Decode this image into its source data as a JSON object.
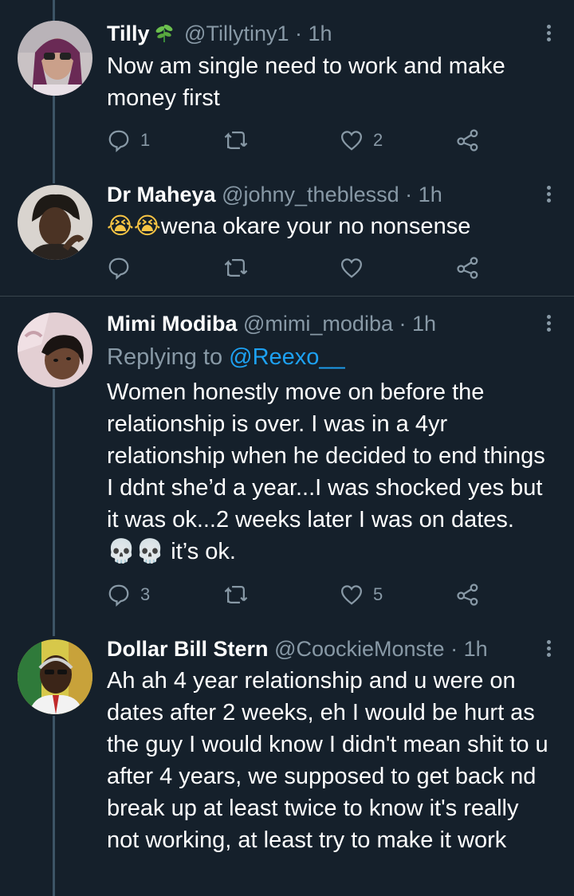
{
  "tweets": [
    {
      "name": "Tilly",
      "handle": "@Tillytiny1",
      "separator": "·",
      "time": "1h",
      "text": "Now am single need to work and make money first",
      "replies": "1",
      "retweets": "",
      "likes": "2"
    },
    {
      "name": "Dr Maheya",
      "handle": "@johny_theblessd",
      "separator": "·",
      "time": "1h",
      "emoji_prefix": "😭😭",
      "text": "wena okare your no nonsense",
      "replies": "",
      "retweets": "",
      "likes": ""
    },
    {
      "name": "Mimi Modiba",
      "handle": "@mimi_modiba",
      "separator": "·",
      "time": "1h",
      "replying_label": "Replying to",
      "replying_to": "@Reexo__",
      "text_line1": "Women honestly move on before the relationship is over. I was in a 4yr relationship when he decided to end things I ddnt she’d a year...I was shocked yes but it was ok...2 weeks later I was on dates.",
      "emoji_mid": "💀💀",
      "text_tail": " it’s ok.",
      "replies": "3",
      "retweets": "",
      "likes": "5"
    },
    {
      "name": "Dollar Bill Stern",
      "handle": "@CoockieMonste",
      "separator": "·",
      "time": "1h",
      "text": "Ah ah 4 year relationship and u were on dates after 2 weeks, eh I would be hurt as the guy I would know I didn't mean shit to u after 4 years, we supposed to get back nd break up at least twice to know it's really not working, at least try to make it work"
    }
  ],
  "icons": {
    "reply": "reply-bubble-icon",
    "retweet": "retweet-icon",
    "like": "heart-icon",
    "share": "share-icon",
    "more": "more-vertical-icon"
  },
  "colors": {
    "background": "#15202b",
    "secondary_text": "#8899a6",
    "link": "#1da1f2",
    "thread_line": "#3d5466"
  }
}
